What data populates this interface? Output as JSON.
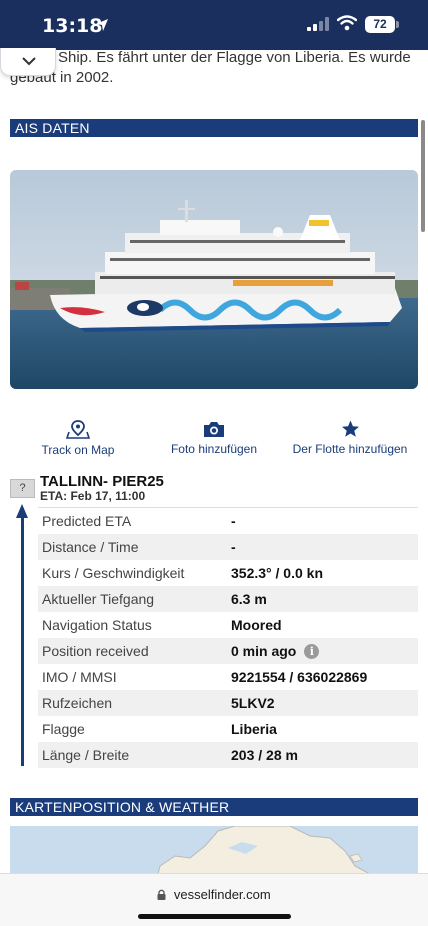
{
  "status_bar": {
    "time": "13:18",
    "battery": "72"
  },
  "intro_text": "Ship. Es fährt unter der Flagge von Liberia. Es wurde gebaut in 2002.",
  "sections": {
    "ais": "AIS DATEN",
    "map": "KARTENPOSITION & WEATHER"
  },
  "actions": [
    {
      "label": "Track on Map",
      "icon": "map-pin-icon"
    },
    {
      "label": "Foto hinzufügen",
      "icon": "camera-icon"
    },
    {
      "label": "Der Flotte hinzufügen",
      "icon": "star-icon"
    }
  ],
  "destination": {
    "help": "?",
    "name": "TALLINN- PIER25",
    "eta": "ETA: Feb 17, 11:00"
  },
  "ais_rows": [
    {
      "label": "Predicted ETA",
      "value": "-"
    },
    {
      "label": "Distance / Time",
      "value": "-"
    },
    {
      "label": "Kurs / Geschwindigkeit",
      "value": "352.3° / 0.0 kn"
    },
    {
      "label": "Aktueller Tiefgang",
      "value": "6.3 m"
    },
    {
      "label": "Navigation Status",
      "value": "Moored"
    },
    {
      "label": "Position received",
      "value": "0 min ago",
      "info": "i"
    },
    {
      "label": "IMO / MMSI",
      "value": "9221554 / 636022869"
    },
    {
      "label": "Rufzeichen",
      "value": "5LKV2"
    },
    {
      "label": "Flagge",
      "value": "Liberia"
    },
    {
      "label": "Länge / Breite",
      "value": "203 / 28 m"
    }
  ],
  "browser": {
    "url": "vesselfinder.com"
  },
  "colors": {
    "brand_navy": "#1b2f5e",
    "section_blue": "#1b3c7a"
  }
}
